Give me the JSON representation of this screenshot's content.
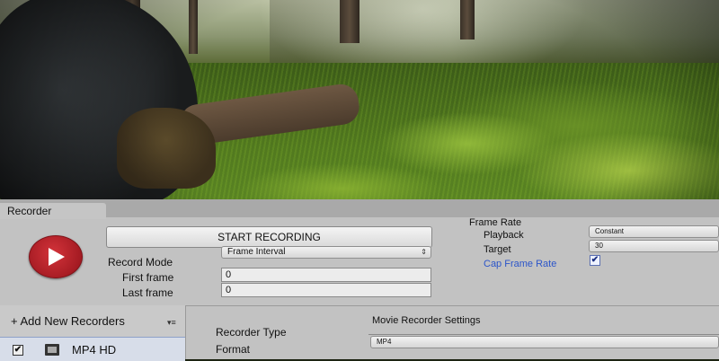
{
  "window": {
    "tab_title": "Recorder"
  },
  "recorder": {
    "start_label": "START RECORDING",
    "record_mode_label": "Record Mode",
    "record_mode_value": "Frame Interval",
    "first_frame_label": "First frame",
    "first_frame_value": "0",
    "last_frame_label": "Last frame",
    "last_frame_value": "0"
  },
  "frame_rate": {
    "title": "Frame Rate",
    "playback_label": "Playback",
    "playback_value": "Constant",
    "target_label": "Target",
    "target_value": "30",
    "cap_label": "Cap Frame Rate",
    "cap_checked": true,
    "cap_check_glyph": "✔"
  },
  "recorders_list": {
    "add_label": "+ Add New Recorders",
    "menu_glyph": "▾≡",
    "items": [
      {
        "label": "MP4 HD",
        "enabled": true,
        "check_glyph": "✔"
      }
    ]
  },
  "settings": {
    "recorder_type_label": "Recorder Type",
    "format_label": "Format",
    "settings_title": "Movie Recorder Settings",
    "format_value": "MP4"
  },
  "colors": {
    "record_button": "#c0262e",
    "link_blue": "#2c55c9",
    "panel_bg": "#c2c2c2"
  },
  "icons": {
    "record": "play-triangle-icon",
    "media": "film-icon",
    "dropdown": "chevron-updown-icon"
  }
}
